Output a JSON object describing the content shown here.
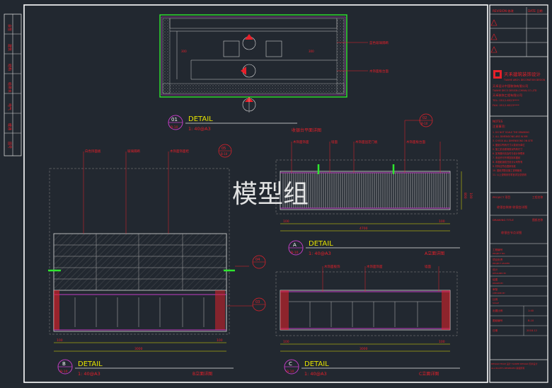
{
  "watermark": "模型组",
  "views": {
    "plan": {
      "num": "01",
      "ref": "B-10",
      "title": "DETAIL",
      "scale": "1: 40@A3",
      "caption": "收银台平面详图"
    },
    "elev_a": {
      "num": "A",
      "ref": "B-10",
      "title": "DETAIL",
      "scale": "1: 40@A3",
      "caption": "A立面详图",
      "bubble": "02",
      "bubble_ref": "B-10"
    },
    "elev_b": {
      "num": "B",
      "ref": "B-10",
      "title": "DETAIL",
      "scale": "1: 40@A3",
      "caption": "B立面详图",
      "bubble": "05",
      "bubble_ref": "B-10",
      "bubble2": "04",
      "bubble3": "03"
    },
    "elev_c": {
      "num": "C",
      "ref": "B-10",
      "title": "DETAIL",
      "scale": "1: 40@A3",
      "caption": "C立面详图"
    }
  },
  "dims": {
    "a_total": "4700",
    "a_left": "100",
    "a_right": "100",
    "b_total": "3000",
    "b_left": "100",
    "b_right": "100",
    "c_total": "3000",
    "c_left": "100",
    "c_right": "100",
    "a_h1": "800",
    "a_h2": "100"
  },
  "annotations": {
    "plan_1": "蓝色玻璃隔断",
    "plan_2": "木饰面板台面",
    "a_1": "木饰面饰面",
    "a_2": "墙面",
    "a_3": "木饰面固定门板",
    "a_4": "木饰面板台面",
    "b_1": "白色饰面板",
    "b_2": "玻璃隔断",
    "b_3": "木饰面饰面柜",
    "c_1": "木饰面板饰",
    "c_2": "木饰面饰面",
    "c_3": "墙面"
  },
  "title_block": {
    "revision_header": "REVISION 修改",
    "revision_col2": "DATE 日期",
    "company_cn": "天禾建筑装饰设计",
    "company_en": "TIANHE ARCH. DECORATION DESIGN",
    "company_line1": "天禾设计中国装饰有限公司",
    "company_line2": "TIANHE DECO DESIGN (CHINA) CO.,LTD",
    "company_line3": "天禾装饰工程有限公司",
    "tel": "TEL: 0512-6523****",
    "fax": "FAX: 0512-6523****",
    "notes_header": "NOTES",
    "notes_sub": "注意事项:",
    "notes": [
      "1. DO NOT SCALE THE DRAWING",
      "2. ALL DIMENSIONS ARE IN MM",
      "3. CHECK ALL DIMENSIONS ON SITE",
      "4. 图纸中所有尺寸以毫米为单位",
      "5. 施工前请现场核对所有尺寸",
      "6. 如有疑问请及时与设计师联系",
      "7. 未经许可不得复制本图纸",
      "8. 本图纸版权归设计公司所有",
      "9. 材料应符合国家标准",
      "10. 图纸须配合施工说明使用",
      "11. 以上说明未尽事宜详见总说明"
    ],
    "project_label": "PROJECT 项目",
    "project_name": "工程名称",
    "project_value": "收银台装修  收银台详图",
    "drawing_label": "DRAWING TITLE",
    "drawing_tag": "图纸名称",
    "drawing_value": "收银台节点详图",
    "fields": [
      {
        "cn": "工程编号",
        "en": "PROJECT NO.",
        "val": ""
      },
      {
        "cn": "项目负责",
        "en": "PROJECT LEADER",
        "val": ""
      },
      {
        "cn": "设计",
        "en": "DESIGNED BY",
        "val": ""
      },
      {
        "cn": "绘图",
        "en": "DRAWN BY",
        "val": ""
      },
      {
        "cn": "审核",
        "en": "CHECKED BY",
        "val": ""
      },
      {
        "cn": "比例",
        "en": "SCALE",
        "val": ""
      },
      {
        "cn": "出图比例",
        "en": "",
        "val": "1:40"
      },
      {
        "cn": "图纸编号",
        "en": "",
        "val": "B-10"
      },
      {
        "cn": "日期",
        "en": "",
        "val": "2018.12"
      }
    ],
    "bottom_line1": "DESIGN TEAM  设计 TIANHE DESIGN 天禾设计",
    "bottom_line2": "ALL RIGHTS RESERVED 版权所有"
  },
  "left_strip": [
    "会签",
    "建筑",
    "结构",
    "给排水",
    "电气",
    "暖通",
    "图号"
  ],
  "colors": {
    "bg": "#222830",
    "line": "#e6e6e6",
    "accent": "#e8202a",
    "yellow": "#e6e400",
    "magenta": "#c23cc4",
    "green": "#2ee62e"
  }
}
